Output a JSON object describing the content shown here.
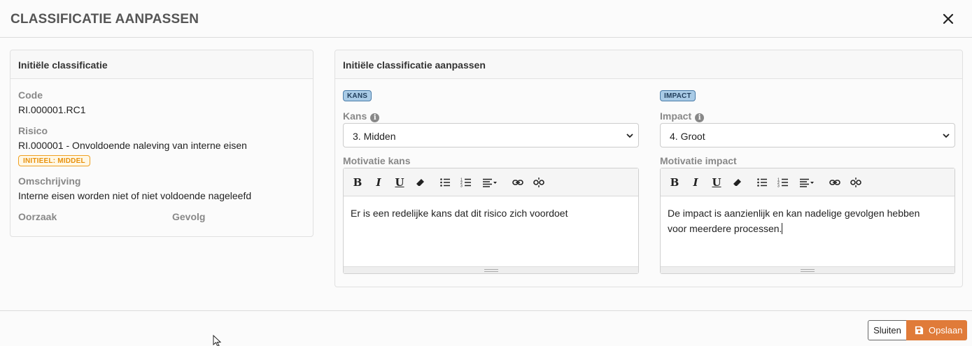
{
  "header": {
    "title": "CLASSIFICATIE AANPASSEN"
  },
  "left_card": {
    "title": "Initiële classificatie",
    "code_label": "Code",
    "code_value": "RI.000001.RC1",
    "risico_label": "Risico",
    "risico_value": "RI.000001 - Onvoldoende naleving van interne eisen",
    "badge": "INITIEEL: MIDDEL",
    "omschrijving_label": "Omschrijving",
    "omschrijving_value": "Interne eisen worden niet of niet voldoende nageleefd",
    "oorzaak_label": "Oorzaak",
    "gevolg_label": "Gevolg"
  },
  "right_card": {
    "title": "Initiële classificatie aanpassen",
    "kans": {
      "badge": "KANS",
      "label": "Kans",
      "selected": "3. Midden",
      "motivatie_label": "Motivatie kans",
      "motivatie_text": "Er is een redelijke kans dat dit risico zich voordoet"
    },
    "impact": {
      "badge": "IMPACT",
      "label": "Impact",
      "selected": "4. Groot",
      "motivatie_label": "Motivatie impact",
      "motivatie_text_line1": "De impact is aanzienlijk en kan nadelige gevolgen hebben",
      "motivatie_text_line2": "voor meerdere processen."
    },
    "toolbar": {
      "bold": "B",
      "italic": "I",
      "underline": "U",
      "info": "i"
    }
  },
  "footer": {
    "close_label": "Sluiten",
    "save_label": "Opslaan"
  },
  "colors": {
    "accent": "#e07b39",
    "badge_blue": "#a9cbe6",
    "badge_orange": "#f0a020"
  },
  "icons": [
    "close-icon",
    "info-icon",
    "eraser-icon",
    "bullet-list-icon",
    "numbered-list-icon",
    "align-icon",
    "link-icon",
    "unlink-icon",
    "save-icon",
    "chevron-down-icon",
    "mouse-cursor-icon"
  ]
}
